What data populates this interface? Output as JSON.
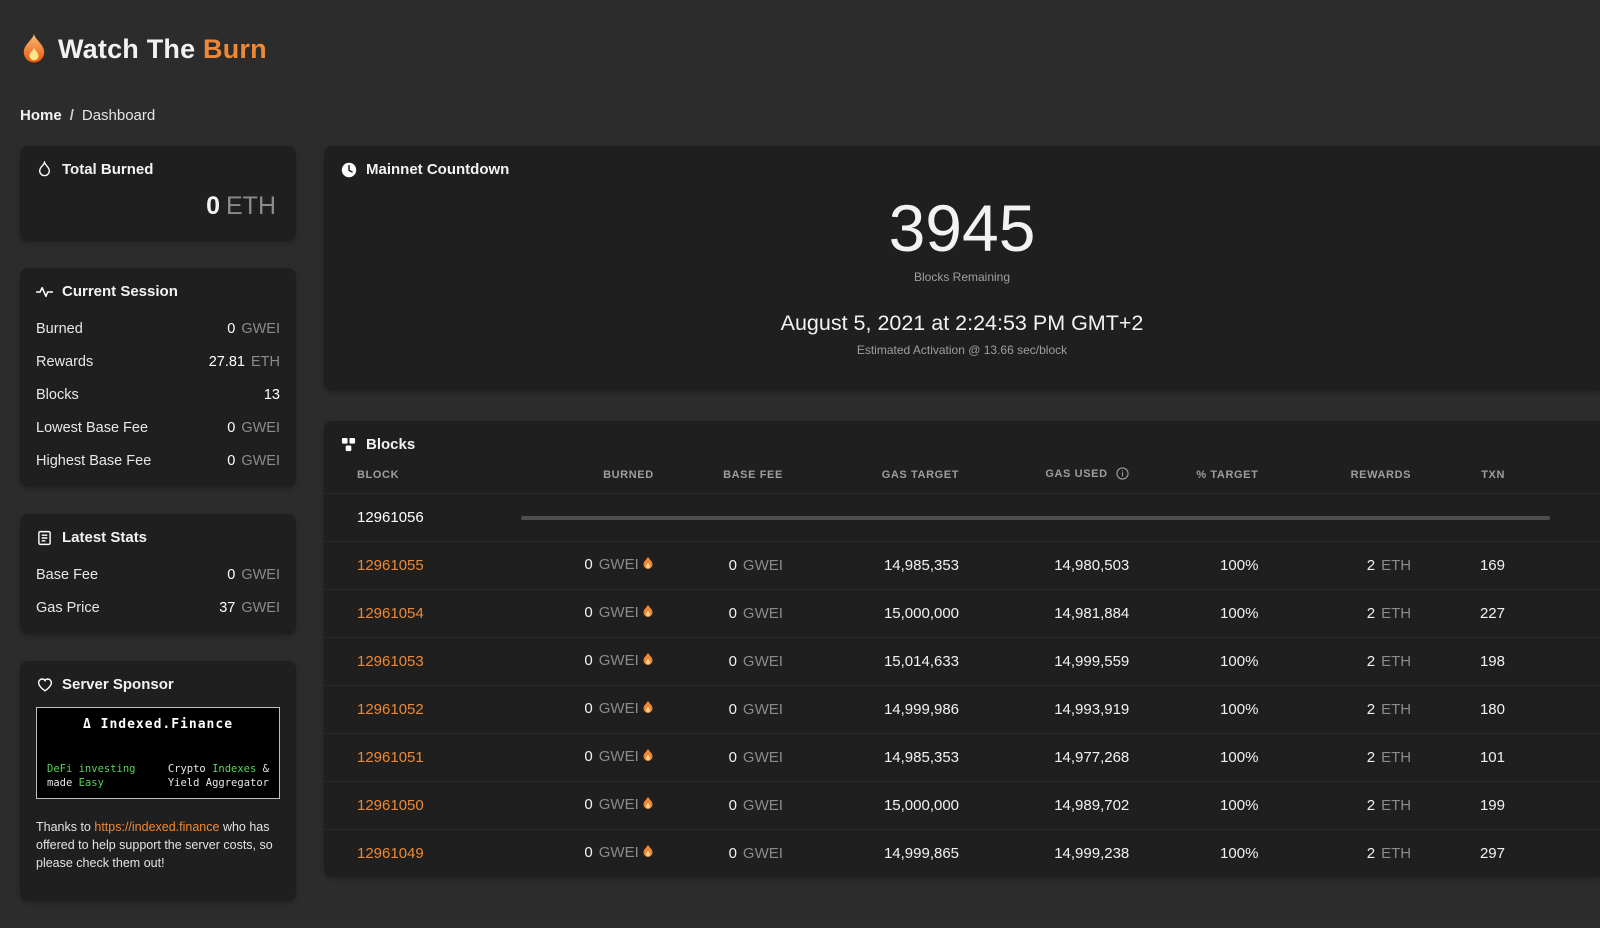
{
  "app": {
    "title_prefix": "Watch The",
    "title_accent": "Burn"
  },
  "breadcrumb": {
    "home": "Home",
    "separator": "/",
    "current": "Dashboard"
  },
  "sidebar": {
    "total_burned": {
      "title": "Total Burned",
      "value": "0",
      "unit": "ETH"
    },
    "current_session": {
      "title": "Current Session",
      "rows": [
        {
          "label": "Burned",
          "value": "0",
          "unit": "GWEI"
        },
        {
          "label": "Rewards",
          "value": "27.81",
          "unit": "ETH"
        },
        {
          "label": "Blocks",
          "value": "13",
          "unit": ""
        },
        {
          "label": "Lowest Base Fee",
          "value": "0",
          "unit": "GWEI"
        },
        {
          "label": "Highest Base Fee",
          "value": "0",
          "unit": "GWEI"
        }
      ]
    },
    "latest_stats": {
      "title": "Latest Stats",
      "rows": [
        {
          "label": "Base Fee",
          "value": "0",
          "unit": "GWEI"
        },
        {
          "label": "Gas Price",
          "value": "37",
          "unit": "GWEI"
        }
      ]
    },
    "sponsor": {
      "title": "Server Sponsor",
      "banner": {
        "logo": "Δ",
        "brand": "Indexed.Finance",
        "left_line1": "DeFi investing",
        "left_line2_pre": "made ",
        "left_line2_accent": "Easy",
        "right_line1_pre": "Crypto ",
        "right_line1_accent": "Indexes",
        "right_line1_post": " &",
        "right_line2": "Yield Aggregator"
      },
      "note_prefix": "Thanks to ",
      "link": "https://indexed.finance",
      "note_suffix": " who has offered to help support the server costs, so please check them out!"
    }
  },
  "countdown": {
    "title": "Mainnet Countdown",
    "value": "3945",
    "caption": "Blocks Remaining",
    "date": "August 5, 2021 at 2:24:53 PM GMT+2",
    "subcaption": "Estimated Activation @ 13.66 sec/block"
  },
  "blocks": {
    "title": "Blocks",
    "columns": [
      "BLOCK",
      "BURNED",
      "BASE FEE",
      "GAS TARGET",
      "GAS USED",
      "% TARGET",
      "REWARDS",
      "TXN"
    ],
    "pending_block": "12961056",
    "rows": [
      {
        "block": "12961055",
        "burned": "0",
        "burned_unit": "GWEI",
        "base_fee": "0",
        "base_fee_unit": "GWEI",
        "gas_target": "14,985,353",
        "gas_used": "14,980,503",
        "pct_target": "100%",
        "reward": "2",
        "reward_unit": "ETH",
        "txn": "169"
      },
      {
        "block": "12961054",
        "burned": "0",
        "burned_unit": "GWEI",
        "base_fee": "0",
        "base_fee_unit": "GWEI",
        "gas_target": "15,000,000",
        "gas_used": "14,981,884",
        "pct_target": "100%",
        "reward": "2",
        "reward_unit": "ETH",
        "txn": "227"
      },
      {
        "block": "12961053",
        "burned": "0",
        "burned_unit": "GWEI",
        "base_fee": "0",
        "base_fee_unit": "GWEI",
        "gas_target": "15,014,633",
        "gas_used": "14,999,559",
        "pct_target": "100%",
        "reward": "2",
        "reward_unit": "ETH",
        "txn": "198"
      },
      {
        "block": "12961052",
        "burned": "0",
        "burned_unit": "GWEI",
        "base_fee": "0",
        "base_fee_unit": "GWEI",
        "gas_target": "14,999,986",
        "gas_used": "14,993,919",
        "pct_target": "100%",
        "reward": "2",
        "reward_unit": "ETH",
        "txn": "180"
      },
      {
        "block": "12961051",
        "burned": "0",
        "burned_unit": "GWEI",
        "base_fee": "0",
        "base_fee_unit": "GWEI",
        "gas_target": "14,985,353",
        "gas_used": "14,977,268",
        "pct_target": "100%",
        "reward": "2",
        "reward_unit": "ETH",
        "txn": "101"
      },
      {
        "block": "12961050",
        "burned": "0",
        "burned_unit": "GWEI",
        "base_fee": "0",
        "base_fee_unit": "GWEI",
        "gas_target": "15,000,000",
        "gas_used": "14,989,702",
        "pct_target": "100%",
        "reward": "2",
        "reward_unit": "ETH",
        "txn": "199"
      },
      {
        "block": "12961049",
        "burned": "0",
        "burned_unit": "GWEI",
        "base_fee": "0",
        "base_fee_unit": "GWEI",
        "gas_target": "14,999,865",
        "gas_used": "14,999,238",
        "pct_target": "100%",
        "reward": "2",
        "reward_unit": "ETH",
        "txn": "297"
      }
    ]
  }
}
